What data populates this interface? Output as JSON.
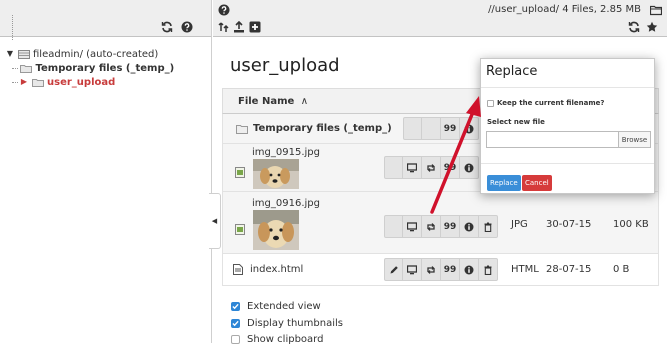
{
  "tree": {
    "root_label": "fileadmin/ (auto-created)",
    "items": [
      {
        "label": "Temporary files (_temp_)"
      },
      {
        "label": "user_upload"
      }
    ]
  },
  "toolbar": {
    "path_info": "//user_upload/ 4 Files, 2.85 MB"
  },
  "main": {
    "title": "user_upload",
    "column_file_name": "File Name",
    "sort_indicator": "∧",
    "rows": [
      {
        "name": "Temporary files (_temp_)"
      },
      {
        "name": "img_0915.jpg"
      },
      {
        "name": "img_0916.jpg",
        "type": "JPG",
        "date": "30-07-15",
        "size": "100 KB"
      },
      {
        "name": "index.html",
        "type": "HTML",
        "date": "28-07-15",
        "size": "0 B"
      }
    ],
    "button_quote_glyph": "99"
  },
  "options": [
    {
      "label": "Extended view",
      "checked": true
    },
    {
      "label": "Display thumbnails",
      "checked": true
    },
    {
      "label": "Show clipboard",
      "checked": false
    }
  ],
  "modal": {
    "title": "Replace",
    "keep_label": "Keep the current filename?",
    "select_label": "Select new file",
    "browse": "Browse",
    "replace": "Replace",
    "cancel": "Cancel"
  },
  "colors": {
    "accent": "#c83c3c",
    "primary": "#3a8ed8",
    "danger": "#d63b3b",
    "arrow": "#d0112b"
  }
}
